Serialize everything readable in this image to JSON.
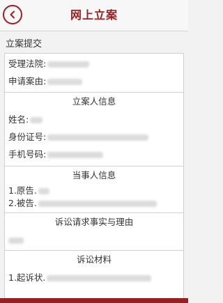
{
  "header": {
    "title": "网上立案",
    "back_icon": "chevron-left-icon"
  },
  "section_label": "立案提交",
  "case_info": {
    "court_label": "受理法院:",
    "cause_label": "申请案由:"
  },
  "filer_info": {
    "title": "立案人信息",
    "name_label": "姓名:",
    "id_label": "身份证号:",
    "phone_label": "手机号码:"
  },
  "parties": {
    "title": "当事人信息",
    "plaintiff_label": "1.原告.",
    "defendant_label": "2.被告."
  },
  "claims": {
    "title": "诉讼请求事实与理由"
  },
  "materials": {
    "title": "诉讼材料",
    "item1_label": "1.起诉状."
  },
  "colors": {
    "accent": "#9e1d20",
    "border": "#cfcfcf",
    "background": "#f2f2f2"
  }
}
